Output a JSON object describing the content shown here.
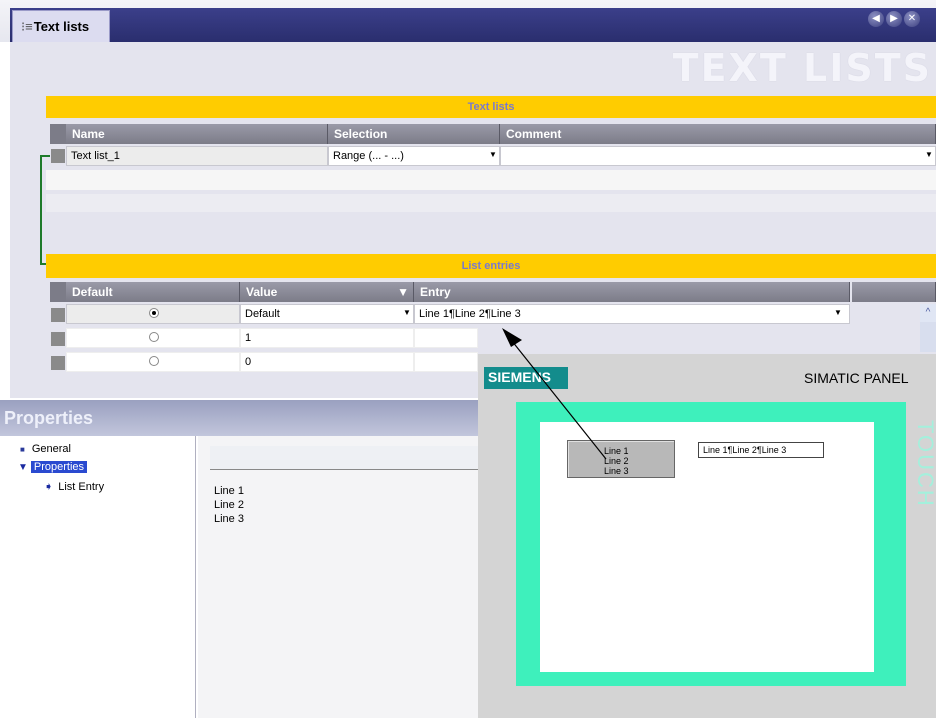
{
  "tab": {
    "label": "Text lists"
  },
  "page_title": "TEXT LISTS",
  "text_lists": {
    "section_title": "Text lists",
    "columns": [
      "Name",
      "Selection",
      "Comment"
    ],
    "rows": [
      {
        "name": "Text list_1",
        "selection": "Range (... - ...)",
        "comment": ""
      }
    ]
  },
  "list_entries": {
    "section_title": "List entries",
    "columns": [
      "Default",
      "Value",
      "Entry"
    ],
    "rows": [
      {
        "default": true,
        "value": "Default",
        "entry": "Line 1¶Line 2¶Line 3"
      },
      {
        "default": false,
        "value": "1",
        "entry": ""
      },
      {
        "default": false,
        "value": "0",
        "entry": ""
      }
    ]
  },
  "properties": {
    "title": "Properties",
    "tree": [
      {
        "label": "General",
        "level": 0,
        "selected": false
      },
      {
        "label": "Properties",
        "level": 0,
        "selected": true
      },
      {
        "label": "List Entry",
        "level": 1,
        "selected": false
      }
    ],
    "text_lines": [
      "Line 1",
      "Line 2",
      "Line 3"
    ]
  },
  "panel": {
    "brand": "SIEMENS",
    "model": "SIMATIC PANEL",
    "side_label": "TOUCH",
    "button_text": [
      "Line 1",
      "Line 2",
      "Line 3"
    ],
    "field_text": "Line 1¶Line 2¶Line 3"
  },
  "colors": {
    "accent_yellow": "#ffcc00",
    "header_navy": "#2a2e6e",
    "siemens_teal": "#138c8c",
    "screen_frame": "#3ef0bc",
    "link_green": "#1e7a2a"
  }
}
